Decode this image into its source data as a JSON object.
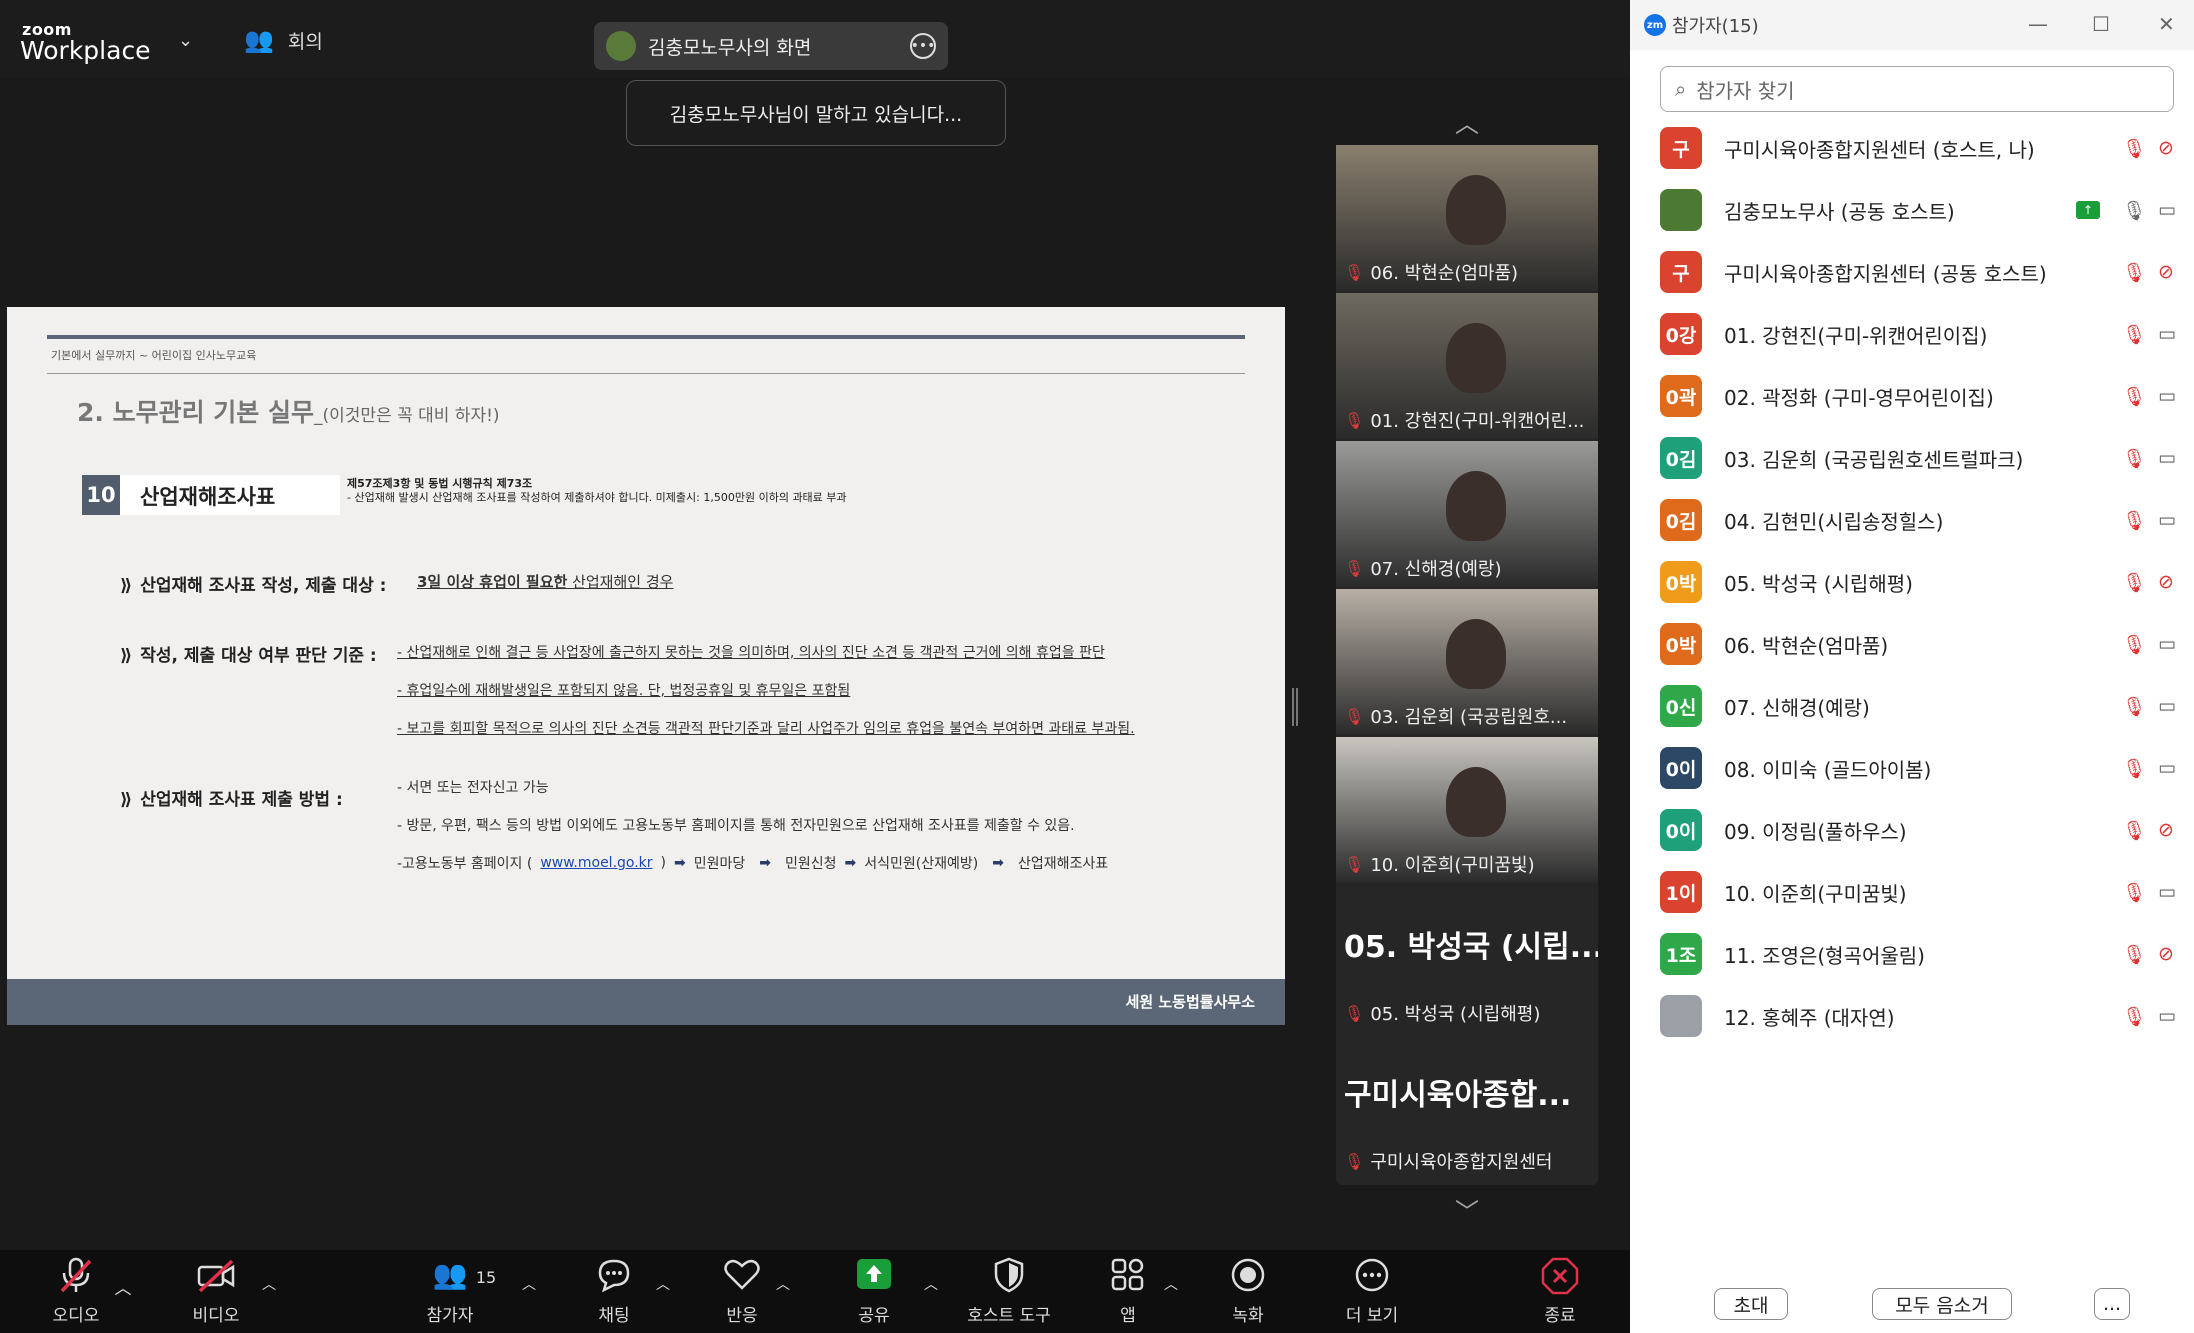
{
  "app": {
    "logo_small": "zoom",
    "logo_big": "Workplace",
    "meeting_label": "회의"
  },
  "share_pill": {
    "label": "김충모노무사의 화면"
  },
  "speaking_toast": "김충모노무사님이 말하고 있습니다...",
  "slide": {
    "crumb": "기본에서 실무까지 ~ 어린이집 인사노무교육",
    "heading": "2. 노무관리 기본 실무",
    "heading_sub": "_(이것만은 꼭 대비 하자!)",
    "num": "10",
    "title": "산업재해조사표",
    "law_line1": "제57조제3항 및 동법 시행규칙 제73조",
    "law_line2": "- 산업재해 발생시 산업재해 조사표를 작성하여 제출하셔야 합니다. 미제출시: 1,500만원 이하의 과태료 부과",
    "sec1_label": "산업재해 조사표 작성, 제출 대상 :",
    "sec1_value_bold": "3일 이상 휴업이 필요한",
    "sec1_value": " 산업재해인 경우",
    "sec2_label": "작성, 제출 대상 여부 판단 기준 :",
    "sec2_lines": [
      "- 산업재해로 인해 결근 등 사업장에 출근하지 못하는 것을 의미하며, 의사의 진단 소견 등 객관적 근거에 의해 휴업을 판단",
      "- 휴업일수에 재해발생일은 포함되지 않음. 단, 법정공휴일 및 휴무일은 포함됨",
      "- 보고를 회피할 목적으로 의사의 진단 소견등 객관적 판단기준과 달리 사업주가 임의로 휴업을 불연속 부여하면 과태료 부과됨."
    ],
    "sec3_label": "산업재해 조사표 제출 방법 :",
    "sec3_lines": [
      "- 서면 또는 전자신고 가능",
      "- 방문, 우편, 팩스 등의 방법 이외에도 고용노동부 홈페이지를 통해 전자민원으로 산업재해 조사표를 제출할 수 있음."
    ],
    "path_prefix": "-고용노동부 홈페이지  (",
    "path_link": "www.moel.go.kr",
    "path_suffix": ")",
    "path_steps": [
      "민원마당",
      "민원신청",
      "서식민원(산재예방)",
      "산업재해조사표"
    ],
    "footer": "세원 노동법률사무소"
  },
  "gallery": {
    "tiles": [
      {
        "caption": "06. 박현순(엄마품)",
        "type": "video",
        "bg": "#8a7f6e"
      },
      {
        "caption": "01. 강현진(구미-위캔어린...",
        "type": "video",
        "bg": "#6f6a60"
      },
      {
        "caption": "07. 신해경(예랑)",
        "type": "video",
        "bg": "#9a9a98"
      },
      {
        "caption": "03. 김운희 (국공립원호...",
        "type": "video",
        "bg": "#b8b0a6"
      },
      {
        "caption": "10. 이준희(구미꿈빛)",
        "type": "video",
        "bg": "#c9c6c0"
      },
      {
        "caption": "05. 박성국 (시립해평)",
        "type": "name",
        "big": "05. 박성국 (시립..."
      },
      {
        "caption": "구미시육아종합지원센터",
        "type": "name",
        "big": "구미시육아종합..."
      }
    ]
  },
  "toolbar": {
    "audio": "오디오",
    "video": "비디오",
    "participants": "참가자",
    "participants_count": "15",
    "chat": "채팅",
    "react": "반응",
    "share": "공유",
    "host_tools": "호스트 도구",
    "apps": "앱",
    "record": "녹화",
    "more": "더 보기",
    "end": "종료"
  },
  "panel": {
    "title": "참가자(15)",
    "search_placeholder": "참가자 찾기",
    "participants": [
      {
        "avatar": "구",
        "color": "#d9432f",
        "name": "구미시육아종합지원센터 (호스트, 나)",
        "cam_off": true
      },
      {
        "avatar": "",
        "color": "#4c7a32",
        "name": "김충모노무사 (공동 호스트)",
        "cam_off": false,
        "sharing": true,
        "mic_on": true
      },
      {
        "avatar": "구",
        "color": "#d9432f",
        "name": "구미시육아종합지원센터 (공동 호스트)",
        "cam_off": true
      },
      {
        "avatar": "0강",
        "color": "#d9432f",
        "name": "01. 강현진(구미-위캔어린이집)",
        "cam_off": false
      },
      {
        "avatar": "0곽",
        "color": "#e06a1c",
        "name": "02. 곽정화 (구미-영무어린이집)",
        "cam_off": false
      },
      {
        "avatar": "0김",
        "color": "#1ea07a",
        "name": "03. 김운희  (국공립원호센트럴파크)",
        "cam_off": false
      },
      {
        "avatar": "0김",
        "color": "#e06a1c",
        "name": "04. 김현민(시립송정힐스)",
        "cam_off": false
      },
      {
        "avatar": "0박",
        "color": "#f09c1a",
        "name": "05. 박성국 (시립해평)",
        "cam_off": true
      },
      {
        "avatar": "0박",
        "color": "#e06a1c",
        "name": "06. 박현순(엄마품)",
        "cam_off": false
      },
      {
        "avatar": "0신",
        "color": "#2fa84a",
        "name": "07. 신해경(예랑)",
        "cam_off": false
      },
      {
        "avatar": "0이",
        "color": "#2c4866",
        "name": "08. 이미숙 (골드아이봄)",
        "cam_off": false
      },
      {
        "avatar": "0이",
        "color": "#1ea07a",
        "name": "09. 이정림(풀하우스)",
        "cam_off": true
      },
      {
        "avatar": "1이",
        "color": "#d9432f",
        "name": "10. 이준희(구미꿈빛)",
        "cam_off": false
      },
      {
        "avatar": "1조",
        "color": "#2fa84a",
        "name": "11. 조영은(형곡어울림)",
        "cam_off": true
      },
      {
        "avatar": "",
        "color": "#9aa0a6",
        "name": "12. 홍혜주 (대자연)",
        "cam_off": false
      }
    ],
    "invite": "초대",
    "mute_all": "모두 음소거",
    "more": "..."
  }
}
